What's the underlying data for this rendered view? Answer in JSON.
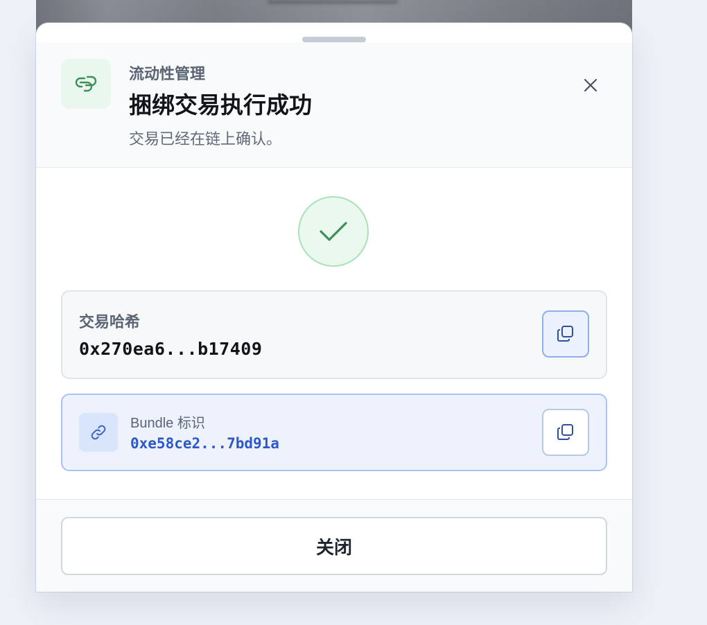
{
  "header": {
    "eyebrow": "流动性管理",
    "title": "捆绑交易执行成功",
    "subtitle": "交易已经在链上确认。"
  },
  "icons": {
    "header_icon": "chain-link-icon",
    "close": "close-icon",
    "status": "checkmark-icon",
    "copy": "copy-icon",
    "bundle": "link-icon"
  },
  "transaction": {
    "hash_label": "交易哈希",
    "hash_value": "0x270ea6...b17409"
  },
  "bundle": {
    "label": "Bundle 标识",
    "value": "0xe58ce2...7bd91a"
  },
  "footer": {
    "close_label": "关闭"
  },
  "colors": {
    "success": "#3d8f5a",
    "accent": "#2d59c8",
    "text_primary": "#111418",
    "text_secondary": "#5b6473"
  }
}
